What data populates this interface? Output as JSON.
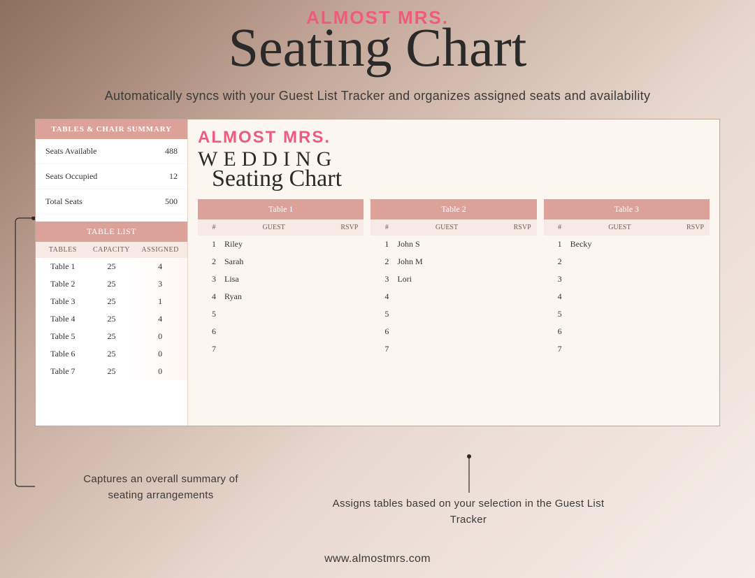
{
  "brand": "ALMOST MRS.",
  "hero_title": "Seating Chart",
  "subtitle": "Automatically syncs with your Guest List Tracker and organizes assigned seats and availability",
  "summary": {
    "heading": "TABLES & CHAIR SUMMARY",
    "rows": [
      {
        "label": "Seats Available",
        "value": "488"
      },
      {
        "label": "Seats Occupied",
        "value": "12"
      },
      {
        "label": "Total Seats",
        "value": "500"
      }
    ]
  },
  "tablelist": {
    "heading": "TABLE LIST",
    "cols": [
      "TABLES",
      "CAPACITY",
      "ASSIGNED"
    ],
    "rows": [
      {
        "name": "Table 1",
        "capacity": "25",
        "assigned": "4"
      },
      {
        "name": "Table 2",
        "capacity": "25",
        "assigned": "3"
      },
      {
        "name": "Table 3",
        "capacity": "25",
        "assigned": "1"
      },
      {
        "name": "Table 4",
        "capacity": "25",
        "assigned": "4"
      },
      {
        "name": "Table 5",
        "capacity": "25",
        "assigned": "0"
      },
      {
        "name": "Table 6",
        "capacity": "25",
        "assigned": "0"
      },
      {
        "name": "Table 7",
        "capacity": "25",
        "assigned": "0"
      }
    ]
  },
  "main_panel": {
    "brand": "ALMOST MRS.",
    "title_serif": "WEDDING",
    "title_script": "Seating Chart",
    "table_cols": [
      "#",
      "GUEST",
      "RSVP"
    ],
    "tables": [
      {
        "heading": "Table 1",
        "guests": [
          "Riley",
          "Sarah",
          "Lisa",
          "Ryan",
          "",
          "",
          ""
        ]
      },
      {
        "heading": "Table 2",
        "guests": [
          "John S",
          "John M",
          "Lori",
          "",
          "",
          "",
          ""
        ]
      },
      {
        "heading": "Table 3",
        "guests": [
          "Becky",
          "",
          "",
          "",
          "",
          "",
          ""
        ]
      }
    ]
  },
  "captions": {
    "left": "Captures an overall summary of seating arrangements",
    "mid": "Assigns tables based on your selection in the Guest List Tracker"
  },
  "footer_url": "www.almostmrs.com"
}
